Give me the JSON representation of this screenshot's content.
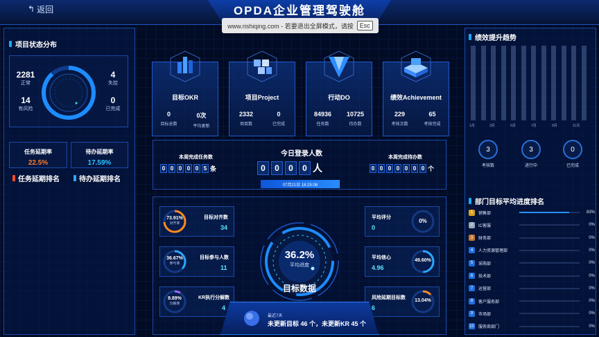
{
  "header": {
    "back_label": "返回",
    "title": "OPDA企业管理驾驶舱",
    "fullscreen_tip": "www.rishiqing.com - 若要退出全屏模式，请按",
    "esc_label": "Esc"
  },
  "project_status": {
    "title": "项目状态分布",
    "normal_value": "2281",
    "normal_label": "正常",
    "risk_value": "14",
    "risk_label": "有风险",
    "out_of_control_value": "4",
    "out_of_control_label": "失控",
    "completed_value": "0",
    "completed_label": "已完成"
  },
  "delay": {
    "task_title": "任务延期率",
    "task_value": "22.5%",
    "todo_title": "待办延期率",
    "todo_value": "17.59%",
    "task_rank_title": "任务延期排名",
    "todo_rank_title": "待办延期排名"
  },
  "cards": [
    {
      "title": "目标OKR",
      "v1": "0",
      "l1": "目标总数",
      "v2": "0次",
      "l2": "平均更新"
    },
    {
      "title": "项目Project",
      "v1": "2332",
      "l1": "项目数",
      "v2": "0",
      "l2": "已完成"
    },
    {
      "title": "行动DO",
      "v1": "84936",
      "l1": "任务数",
      "v2": "10725",
      "l2": "待办数"
    },
    {
      "title": "绩效Achievement",
      "v1": "229",
      "l1": "考核次数",
      "v2": "65",
      "l2": "考核完成"
    }
  ],
  "counters": {
    "weekly_tasks_label": "本周完成任务数",
    "weekly_tasks_digits": [
      "0",
      "0",
      "0",
      "0",
      "0",
      "5"
    ],
    "weekly_tasks_unit": "条",
    "login_label": "今日登录人数",
    "login_digits": [
      "0",
      "0",
      "0",
      "0"
    ],
    "login_unit": "人",
    "login_time": "07月21日 18:25:06",
    "weekly_todos_label": "本周完成待办数",
    "weekly_todos_digits": [
      "0",
      "0",
      "0",
      "0",
      "0",
      "0",
      "0"
    ],
    "weekly_todos_unit": "个"
  },
  "goal_data": {
    "center_value": "36.2%",
    "center_label": "平均进度",
    "title": "目标数据",
    "left": [
      {
        "ring_value": "73.91%",
        "ring_label": "对齐率",
        "label": "目标对齐数",
        "value": "34",
        "ring_color": "#ff8a1f",
        "pct": 0.7391
      },
      {
        "ring_value": "36.67%",
        "ring_label": "参与率",
        "label": "目标参与人数",
        "value": "11",
        "ring_color": "#2aa8ff",
        "pct": 0.3667
      },
      {
        "ring_value": "8.89%",
        "ring_label": "分解率",
        "label": "KR执行分解数",
        "value": "4",
        "ring_color": "#a06bff",
        "pct": 0.0889
      }
    ],
    "right": [
      {
        "label": "平均评分",
        "value": "0",
        "ring_value": "0%",
        "ring_color": "#2aa8ff",
        "pct": 0
      },
      {
        "label": "平均信心",
        "value": "4.96",
        "ring_value": "49.60%",
        "ring_color": "#2aa8ff",
        "pct": 0.496
      },
      {
        "label": "风险延期目标数",
        "value": "6",
        "ring_value": "13.04%",
        "ring_color": "#ff8a1f",
        "pct": 0.1304
      }
    ]
  },
  "notice": {
    "label": "最近7天",
    "text": "未更新目标 46 个，未更新KR 45 个"
  },
  "performance": {
    "title": "绩效提升趋势",
    "axis_labels": [
      "1月",
      "3月",
      "5月",
      "7月",
      "9月",
      "11月"
    ],
    "circles": [
      {
        "value": "3",
        "label": "考核数"
      },
      {
        "value": "3",
        "label": "进行中"
      },
      {
        "value": "0",
        "label": "已完成"
      }
    ]
  },
  "dept_rank": {
    "title": "部门目标平均进度排名",
    "items": [
      {
        "idx": "1",
        "name": "销售部",
        "pct": "83%",
        "fill": 0.83,
        "color": "#d8a21e"
      },
      {
        "idx": "2",
        "name": "IC客服",
        "pct": "0%",
        "fill": 0,
        "color": "#9aa8c0"
      },
      {
        "idx": "3",
        "name": "财务部",
        "pct": "0%",
        "fill": 0,
        "color": "#c6772e"
      },
      {
        "idx": "4",
        "name": "人力资源管理部",
        "pct": "0%",
        "fill": 0,
        "color": "#1f6fe0"
      },
      {
        "idx": "5",
        "name": "采购部",
        "pct": "0%",
        "fill": 0,
        "color": "#1f6fe0"
      },
      {
        "idx": "6",
        "name": "技术部",
        "pct": "0%",
        "fill": 0,
        "color": "#1f6fe0"
      },
      {
        "idx": "7",
        "name": "运营部",
        "pct": "0%",
        "fill": 0,
        "color": "#1f6fe0"
      },
      {
        "idx": "8",
        "name": "客户服务部",
        "pct": "0%",
        "fill": 0,
        "color": "#1f6fe0"
      },
      {
        "idx": "9",
        "name": "市场部",
        "pct": "0%",
        "fill": 0,
        "color": "#1f6fe0"
      },
      {
        "idx": "10",
        "name": "服务商部门",
        "pct": "0%",
        "fill": 0,
        "color": "#1f6fe0"
      }
    ]
  }
}
